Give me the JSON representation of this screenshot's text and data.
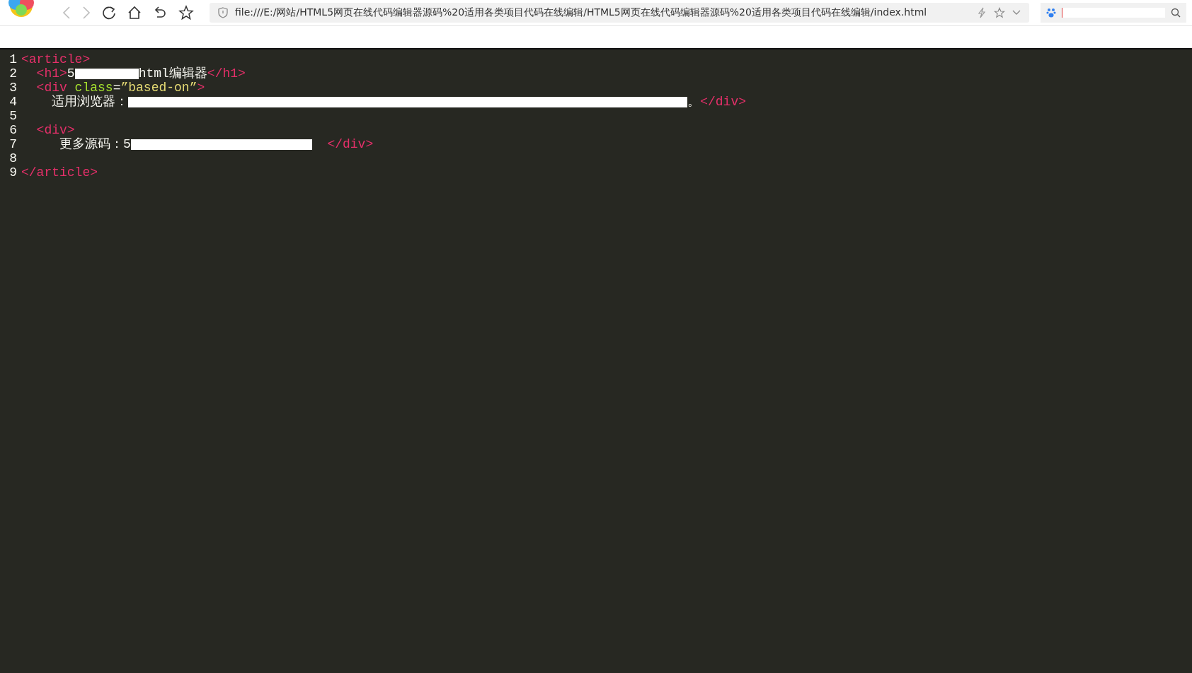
{
  "toolbar": {
    "address": "file:///E:/网站/HTML5网页在线代码编辑器源码%20适用各类项目代码在线编辑/HTML5网页在线代码编辑器源码%20适用各类项目代码在线编辑/index.html"
  },
  "editor": {
    "lines": [
      {
        "number": "1",
        "segments": [
          {
            "kind": "tag",
            "text": "<article>"
          }
        ]
      },
      {
        "number": "2",
        "segments": [
          {
            "kind": "tag",
            "text": "  <h1>"
          },
          {
            "kind": "text",
            "text": "5"
          },
          {
            "kind": "redaction"
          },
          {
            "kind": "text",
            "text": "html编辑器"
          },
          {
            "kind": "tag",
            "text": "</h1>"
          }
        ]
      },
      {
        "number": "3",
        "segments": [
          {
            "kind": "tag",
            "text": "  <div"
          },
          {
            "kind": "attr",
            "text": " class"
          },
          {
            "kind": "text",
            "text": "="
          },
          {
            "kind": "string",
            "text": "”based-on”"
          },
          {
            "kind": "tag",
            "text": ">"
          }
        ]
      },
      {
        "number": "4",
        "segments": [
          {
            "kind": "text",
            "text": "    适用浏览器："
          },
          {
            "kind": "redaction"
          },
          {
            "kind": "text",
            "text": "。"
          },
          {
            "kind": "tag",
            "text": "</div>"
          }
        ]
      },
      {
        "number": "5"
      },
      {
        "number": "6",
        "segments": [
          {
            "kind": "tag",
            "text": "  <div>"
          }
        ]
      },
      {
        "number": "7",
        "segments": [
          {
            "kind": "text",
            "text": "     更多源码：5"
          },
          {
            "kind": "redaction"
          },
          {
            "kind": "tag",
            "text": "  </div>"
          }
        ]
      },
      {
        "number": "8"
      },
      {
        "number": "9",
        "segments": [
          {
            "kind": "tag",
            "text": "</article>"
          }
        ]
      }
    ]
  }
}
